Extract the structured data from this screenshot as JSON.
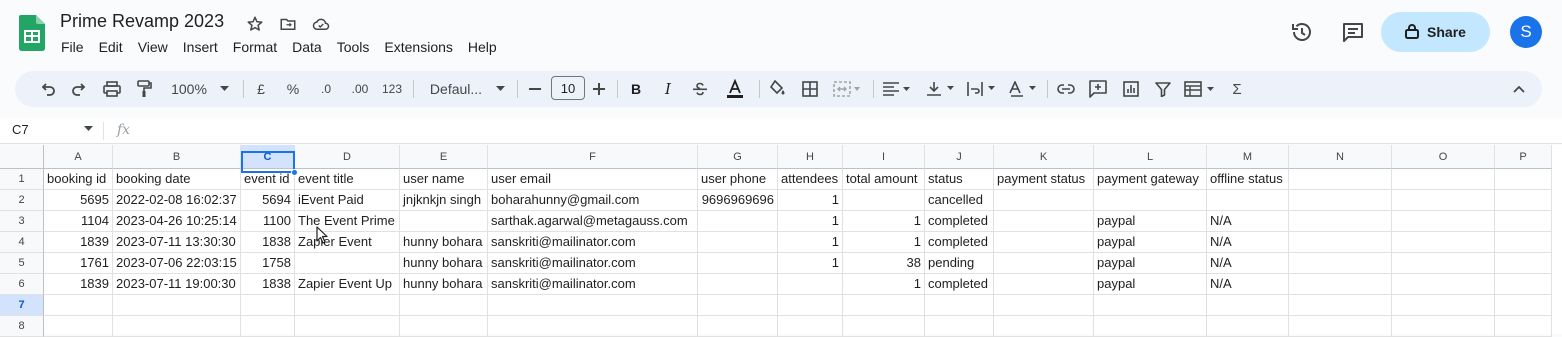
{
  "app": {
    "doc_title": "Prime Revamp 2023",
    "menu": [
      "File",
      "Edit",
      "View",
      "Insert",
      "Format",
      "Data",
      "Tools",
      "Extensions",
      "Help"
    ],
    "share_label": "Share",
    "avatar_initial": "S",
    "accent_color": "#1a73e8",
    "share_bg": "#c2e7ff"
  },
  "toolbar": {
    "zoom": "100%",
    "currency": "£",
    "percent": "%",
    "dec_decrease": ".0",
    "dec_increase": ".00",
    "number_format": "123",
    "font": "Defaul...",
    "font_size": "10",
    "bold": "B",
    "italic": "I",
    "sigma": "Σ"
  },
  "formula_bar": {
    "cell_ref": "C7",
    "fx": "fx"
  },
  "sheet": {
    "columns": [
      "A",
      "B",
      "C",
      "D",
      "E",
      "F",
      "G",
      "H",
      "I",
      "J",
      "K",
      "L",
      "M",
      "N",
      "O",
      "P"
    ],
    "selected_column": "C",
    "selected_row": "7",
    "row_numbers": [
      "1",
      "2",
      "3",
      "4",
      "5",
      "6",
      "7",
      "8"
    ],
    "rows": [
      [
        "booking id",
        "booking date",
        "event id",
        "event title",
        "user name",
        "user email",
        "user phone",
        "attendees",
        "total amount",
        "status",
        "payment status",
        "payment gateway",
        "offline status"
      ],
      [
        "5695",
        "2022-02-08 16:02:37",
        "5694",
        "iEvent Paid",
        "jnjknkjn singh",
        "boharahunny@gmail.com",
        "9696969696",
        "1",
        "",
        "cancelled",
        "",
        "",
        ""
      ],
      [
        "1104",
        "2023-04-26 10:25:14",
        "1100",
        "The Event Prime",
        "",
        "sarthak.agarwal@metagauss.com",
        "",
        "1",
        "1",
        "completed",
        "",
        "paypal",
        "N/A"
      ],
      [
        "1839",
        "2023-07-11 13:30:30",
        "1838",
        "Zapier Event",
        "hunny bohara",
        "sanskriti@mailinator.com",
        "",
        "1",
        "1",
        "completed",
        "",
        "paypal",
        "N/A"
      ],
      [
        "1761",
        "2023-07-06 22:03:15",
        "1758",
        "",
        "hunny bohara",
        "sanskriti@mailinator.com",
        "",
        "1",
        "38",
        "pending",
        "",
        "paypal",
        "N/A"
      ],
      [
        "1839",
        "2023-07-11 19:00:30",
        "1838",
        "Zapier Event Up",
        "hunny bohara",
        "sanskriti@mailinator.com",
        "",
        "",
        "1",
        "completed",
        "",
        "paypal",
        "N/A"
      ],
      [
        "",
        "",
        "",
        "",
        "",
        "",
        "",
        "",
        "",
        "",
        "",
        "",
        ""
      ],
      [
        "",
        "",
        "",
        "",
        "",
        "",
        "",
        "",
        "",
        "",
        "",
        "",
        ""
      ]
    ]
  }
}
